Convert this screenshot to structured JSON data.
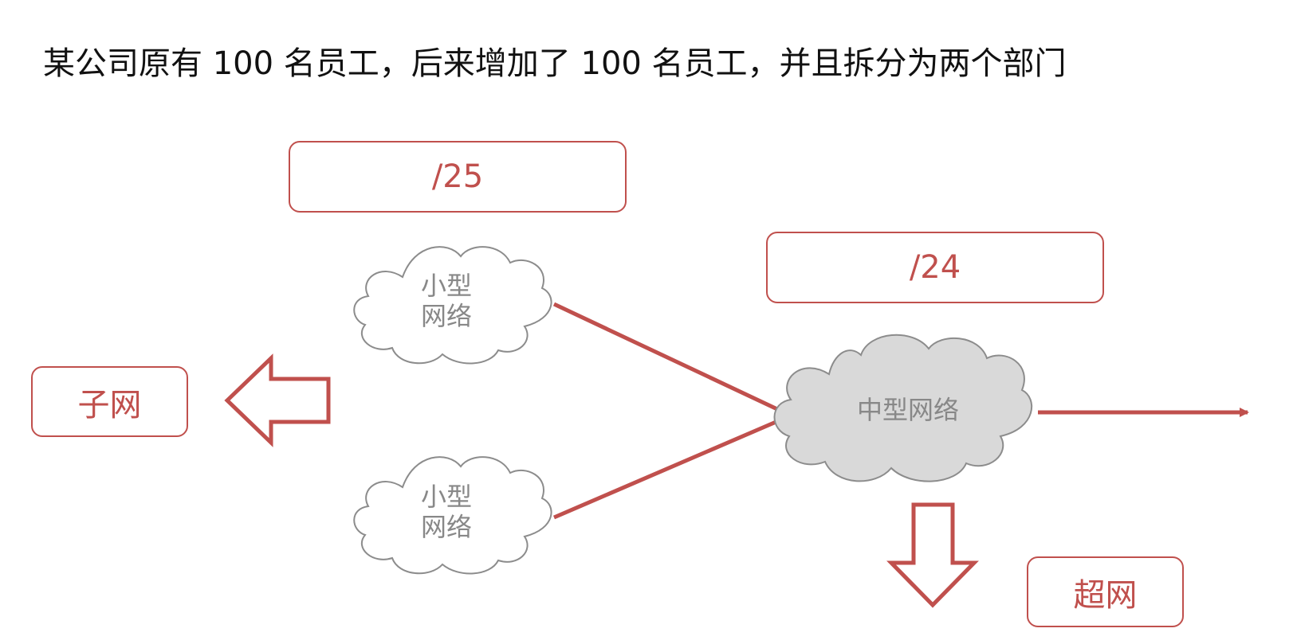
{
  "heading": "某公司原有 100 名员工，后来增加了 100 名员工，并且拆分为两个部门",
  "boxes": {
    "prefix_25": "/25",
    "prefix_24": "/24",
    "subnet": "子网",
    "supernet": "超网"
  },
  "clouds": {
    "small_top": {
      "line1": "小型",
      "line2": "网络"
    },
    "small_bottom": {
      "line1": "小型",
      "line2": "网络"
    },
    "medium": "中型网络"
  },
  "colors": {
    "accent": "#c0504d",
    "cloud_outline": "#8c8c8c",
    "cloud_fill_medium": "#d9d9d9",
    "cloud_text": "#888888"
  },
  "icons": {
    "left_arrow": "hollow-left-arrow-icon",
    "down_arrow": "hollow-down-arrow-icon"
  }
}
